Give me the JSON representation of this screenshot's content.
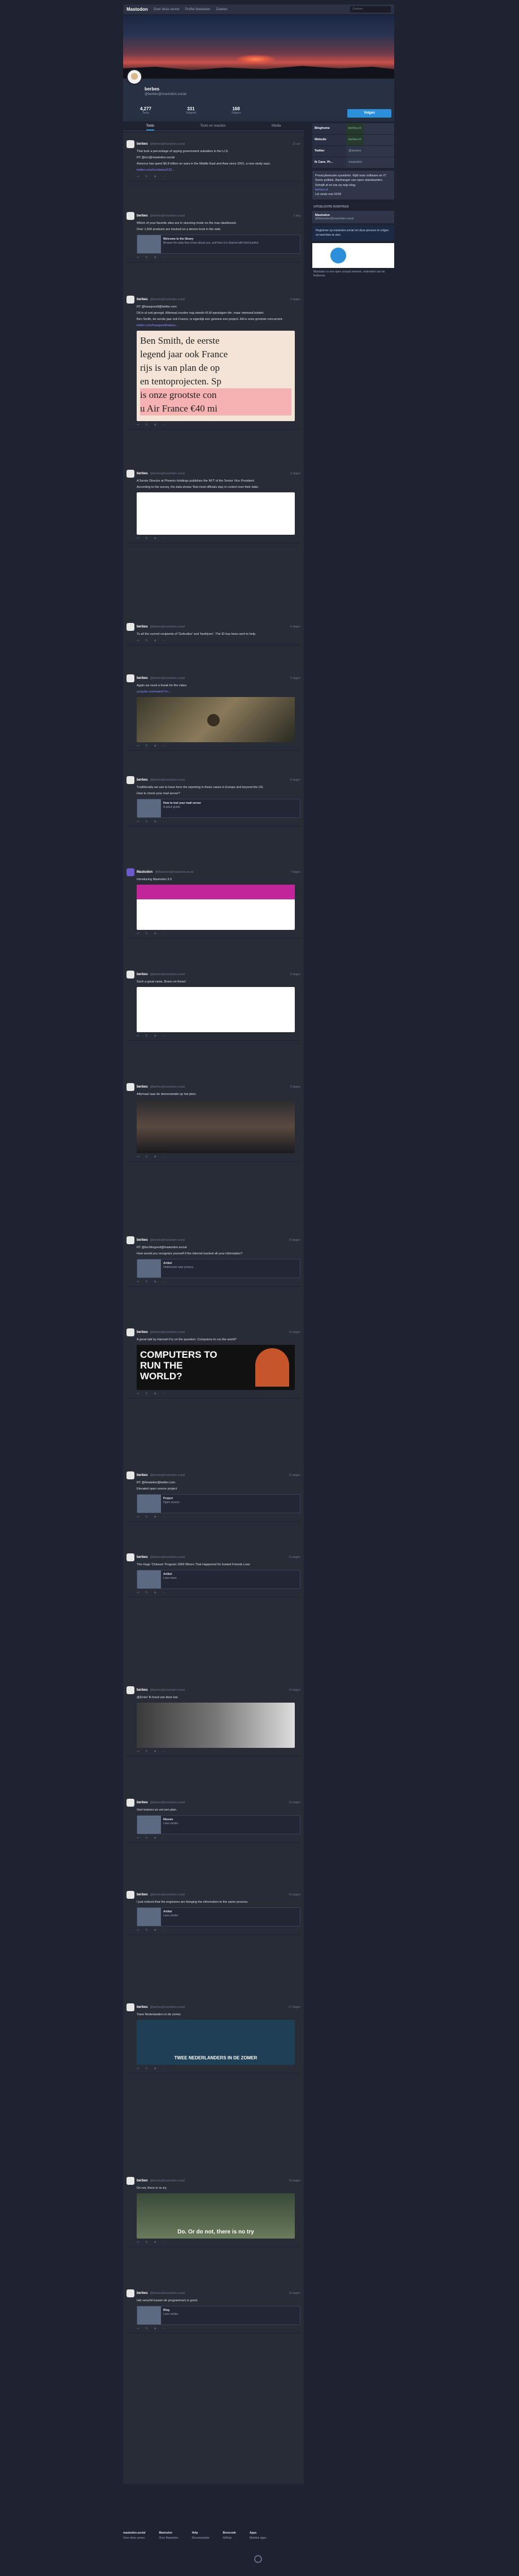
{
  "topbar": {
    "brand": "Mastodon",
    "nav": [
      "Over deze server",
      "Profiel bewerken",
      "Zoeken"
    ],
    "search_placeholder": "Zoeken"
  },
  "profile": {
    "name": "berbes",
    "acct": "@berbes@mastodon.social",
    "stats": [
      {
        "num": "4,277",
        "label": "Toots"
      },
      {
        "num": "331",
        "label": "Volgend"
      },
      {
        "num": "168",
        "label": "Volgers"
      }
    ],
    "follow_label": "Volgen",
    "tabs": [
      "Toots",
      "Toots en reacties",
      "Media"
    ]
  },
  "sidebar": {
    "meta": [
      {
        "k": "Bloghome",
        "v": "berbes.nl",
        "ok": true
      },
      {
        "k": "Website",
        "v": "berbes.nl",
        "ok": true
      },
      {
        "k": "Twitter",
        "v": "@berbes",
        "ok": false
      },
      {
        "k": "Ik Cave. Pr...",
        "v": "mastodon",
        "ok": false
      }
    ],
    "bio": "Privacybewuste sysadmin. Kijkt naar software en IT. Soms politiek. Aanhanger van open standaarden. Schrijft af en toe op mijn blog.",
    "bio_link": "berbes.nl",
    "joined": "Lid sinds mei 2018",
    "featured_heading": "UITGELICHTE HASHTAGS",
    "featured_name": "Mastodon",
    "featured_sub": "@Mastodon@mastodon.social",
    "banner": "Registreer op mastodon.social om deze persoon te volgen en berichten te zien.",
    "note": "Mastodon is een open sociaal netwerk, onderdeel van de fediverse."
  },
  "posts": [
    {
      "name": "berbes",
      "acct": "@berbes@mastodon.social",
      "time": "12 uur",
      "paras": [
        "That took a percentage of spying government subsidies to the U.S.",
        "RT @nrc@mastodon.social",
        "America has spent $6.8 trillion on wars in the Middle East and Asia since 2001, a new study says."
      ],
      "link": "twitter.com/nrc/status/120...",
      "card": false
    },
    {
      "name": "berbes",
      "acct": "@berbes@mastodon.social",
      "time": "1 dag",
      "paras": [
        "Which of your favorite sites are in stunning mode on the mac-dashboard.",
        "Over 1,500 products are tracked on a device level in the web."
      ],
      "link": "",
      "card": true,
      "card_title": "Welcome to the library",
      "card_text": "Browse the data they know about you, and how it is shared with third parties."
    },
    {
      "name": "berbes",
      "acct": "@berbes@mastodon.social",
      "time": "2 dagen",
      "paras": [
        "RT @haasjezelf@twitter.com",
        "Dit is al ooit gezegd. Allemaal zouden nog steeds KLM aanslagen die, maar niemand luistert.",
        "Ben Smith, de eerste jaar ook France, is eigenlijk een gewone een project. AA is onze grootste concurrent."
      ],
      "link": "twitter.com/haasjezelf/status...",
      "card": false
    },
    {
      "name": "berbes",
      "acct": "@berbes@mastodon.social",
      "time": "3 dagen",
      "paras": [
        "A Senior Director at Phoenix Holdings publishes the NFT of the Senior Vice President.",
        "According to the survey, the data shows 'that most officials stay in control over their data'."
      ],
      "link": "",
      "card": false
    },
    {
      "name": "berbes",
      "acct": "@berbes@mastodon.social",
      "time": "4 dagen",
      "paras": [
        "To all the current recipients of 'Gebruiker' and 'bedrijven'. The ID has been sent to help."
      ],
      "link": "",
      "card": false
    },
    {
      "name": "berbes",
      "acct": "@berbes@mastodon.social",
      "time": "5 dagen",
      "paras": [
        "Again we need a break for the video."
      ],
      "link": "youtube.com/watch?v=...",
      "card": false
    },
    {
      "name": "berbes",
      "acct": "@berbes@mastodon.social",
      "time": "6 dagen",
      "paras": [
        "Traditionally we use to have here the reporting in these cases in Europe and beyond the US.",
        "How to check your mail server?"
      ],
      "link": "",
      "card": true,
      "card_title": "How to test your mail server",
      "card_text": "A quick guide."
    },
    {
      "name": "Mastodon",
      "acct": "@Mastodon@mastodon.social",
      "time": "7 dagen",
      "paras": [
        "Introducing Mastodon 3.0"
      ],
      "link": "",
      "card": false
    },
    {
      "name": "berbes",
      "acct": "@berbes@mastodon.social",
      "time": "8 dagen",
      "paras": [
        "Such a great news. Bravo on these!"
      ],
      "link": "",
      "card": false
    },
    {
      "name": "berbes",
      "acct": "@berbes@mastodon.social",
      "time": "9 dagen",
      "paras": [
        "Allemaal naar de demonstratie op het plein."
      ],
      "link": "",
      "card": false
    },
    {
      "name": "berbes",
      "acct": "@berbes@mastodon.social",
      "time": "10 dagen",
      "paras": [
        "RT @techforgood@mastodon.social",
        "How would you recognize yourself if the internet tracked all your information?"
      ],
      "link": "",
      "card": true,
      "card_title": "Artikel",
      "card_text": "Onderzoek naar privacy."
    },
    {
      "name": "berbes",
      "acct": "@berbes@mastodon.social",
      "time": "11 dagen",
      "paras": [
        "A great talk by Hannah Fry on the question: Computers to run the world?"
      ],
      "link": "",
      "card": false
    },
    {
      "name": "berbes",
      "acct": "@berbes@mastodon.social",
      "time": "12 dagen",
      "paras": [
        "RT @ilmatelier@twitter.com",
        "Elevated open source project"
      ],
      "link": "",
      "card": true,
      "card_title": "Project",
      "card_text": "Open source."
    },
    {
      "name": "berbes",
      "acct": "@berbes@mastodon.social",
      "time": "13 dagen",
      "paras": [
        "The Huge 'Chinese' Program 1894 Where That Happened for Instant Friends Lose"
      ],
      "link": "",
      "card": true,
      "card_title": "Artikel",
      "card_text": "Lees meer."
    },
    {
      "name": "berbes",
      "acct": "@berbes@mastodon.social",
      "time": "14 dagen",
      "paras": [
        "@Ernie! Ik houd van deze kat."
      ],
      "link": "",
      "card": false
    },
    {
      "name": "berbes",
      "acct": "@berbes@mastodon.social",
      "time": "15 dagen",
      "paras": [
        "Veel trainers en zet een plan."
      ],
      "link": "",
      "card": true,
      "card_title": "Nieuws",
      "card_text": "Lees verder."
    },
    {
      "name": "berbes",
      "acct": "@berbes@mastodon.social",
      "time": "16 dagen",
      "paras": [
        "I just noticed that the engineers are bringing the information to the same process."
      ],
      "link": "",
      "card": true,
      "card_title": "Artikel",
      "card_text": "Lees verder."
    },
    {
      "name": "berbes",
      "acct": "@berbes@mastodon.social",
      "time": "17 dagen",
      "paras": [
        "Twee Nederlanders in de zomer."
      ],
      "link": "",
      "card": false
    },
    {
      "name": "berbes",
      "acct": "@berbes@mastodon.social",
      "time": "18 dagen",
      "paras": [
        "Do not, there is no try."
      ],
      "link": "",
      "card": false
    },
    {
      "name": "berbes",
      "acct": "@berbes@mastodon.social",
      "time": "19 dagen",
      "paras": [
        "Het verschil tussen de programma's is groot."
      ],
      "link": "",
      "card": true,
      "card_title": "Blog",
      "card_text": "Lees verder."
    }
  ],
  "media_text": {
    "newspaper_lines": [
      "Ben Smith, de eerste",
      "legend jaar ook France",
      "rijs is van plan de op",
      "en tentoprojecten. Sp",
      "is onze grootste con",
      "u Air France €40 mi"
    ],
    "computers": "COMPUTERS TO RUN THE WORLD?",
    "comic_caption": "TWEE NEDERLANDERS IN DE ZOMER",
    "yoda_caption": "Do. Or do not, there is no try"
  },
  "footer": {
    "cols": [
      {
        "h": "mastodon.social",
        "l": "Over deze server"
      },
      {
        "h": "Mastodon",
        "l": "Over Mastodon"
      },
      {
        "h": "Help",
        "l": "Documentatie"
      },
      {
        "h": "Broncode",
        "l": "GitHub"
      },
      {
        "h": "Apps",
        "l": "Mobiele apps"
      }
    ]
  }
}
